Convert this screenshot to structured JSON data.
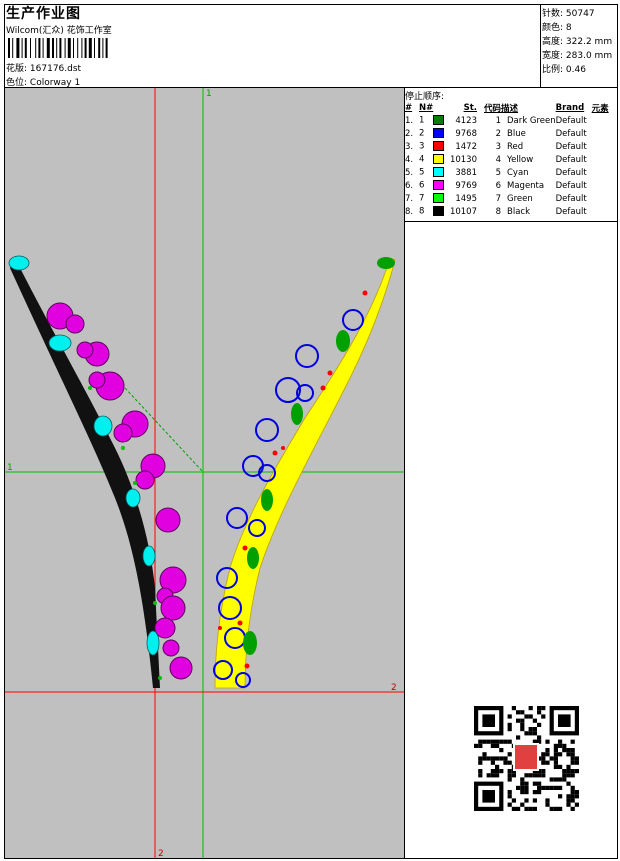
{
  "header": {
    "title": "生产作业图",
    "company": "Wilcom(汇众) 花饰工作室",
    "pattern_label": "花版:",
    "pattern_value": "167176.dst",
    "colorway_label": "色位:",
    "colorway_value": "Colorway 1"
  },
  "stats": [
    {
      "label": "针数:",
      "value": "50747"
    },
    {
      "label": "颜色:",
      "value": "8"
    },
    {
      "label": "高度:",
      "value": "322.2 mm"
    },
    {
      "label": "宽度:",
      "value": "283.0 mm"
    },
    {
      "label": "比例:",
      "value": "0.46"
    }
  ],
  "canvas": {
    "axis_label_top_green": "1",
    "axis_label_left_green": "1",
    "axis_label_right_red": "2",
    "axis_label_bottom_red": "2"
  },
  "stop_sequence": {
    "title": "停止顺序:",
    "headers": [
      "#",
      "N#",
      "St.",
      "代码",
      "描述",
      "Brand",
      "元素"
    ],
    "rows": [
      {
        "num": "1.",
        "n": "1",
        "color": "#008000",
        "st": "4123",
        "code": "1",
        "desc": "Dark Green",
        "brand": "Default"
      },
      {
        "num": "2.",
        "n": "2",
        "color": "#0000ff",
        "st": "9768",
        "code": "2",
        "desc": "Blue",
        "brand": "Default"
      },
      {
        "num": "3.",
        "n": "3",
        "color": "#ff0000",
        "st": "1472",
        "code": "3",
        "desc": "Red",
        "brand": "Default"
      },
      {
        "num": "4.",
        "n": "4",
        "color": "#ffff00",
        "st": "10130",
        "code": "4",
        "desc": "Yellow",
        "brand": "Default"
      },
      {
        "num": "5.",
        "n": "5",
        "color": "#00ffff",
        "st": "3881",
        "code": "5",
        "desc": "Cyan",
        "brand": "Default"
      },
      {
        "num": "6.",
        "n": "6",
        "color": "#ff00ff",
        "st": "9769",
        "code": "6",
        "desc": "Magenta",
        "brand": "Default"
      },
      {
        "num": "7.",
        "n": "7",
        "color": "#00ff00",
        "st": "1495",
        "code": "7",
        "desc": "Green",
        "brand": "Default"
      },
      {
        "num": "8.",
        "n": "8",
        "color": "#000000",
        "st": "10107",
        "code": "8",
        "desc": "Black",
        "brand": "Default"
      }
    ]
  },
  "qr": {
    "stamp_text": "以图\n版图"
  }
}
